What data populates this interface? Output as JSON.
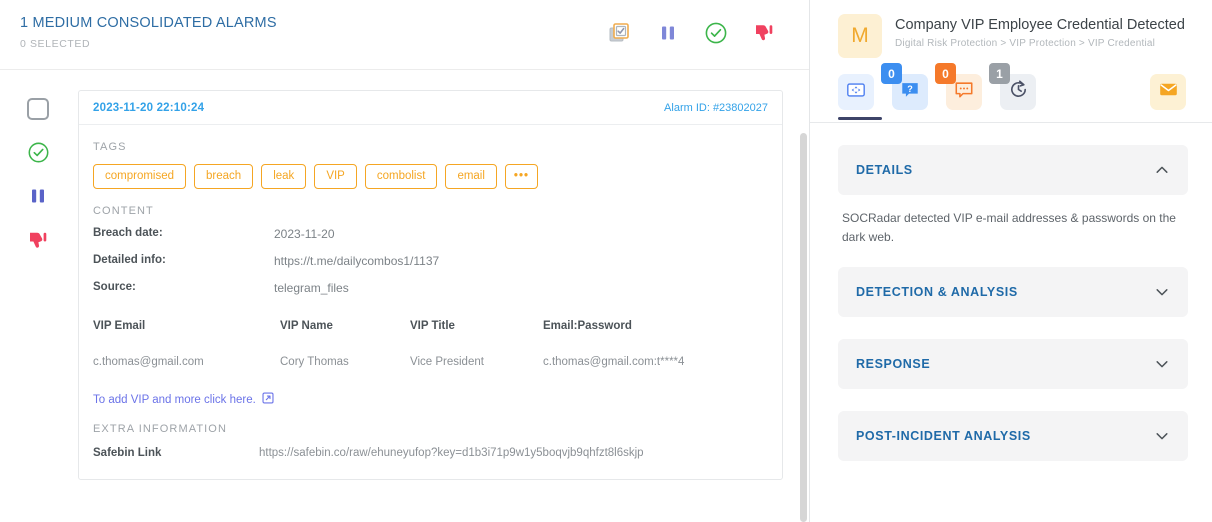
{
  "left": {
    "header": {
      "title": "1 MEDIUM CONSOLIDATED ALARMS",
      "subtitle": "0 SELECTED",
      "actions": [
        {
          "name": "select-all-icon",
          "label": "Select all"
        },
        {
          "name": "pause-icon",
          "label": "Pause"
        },
        {
          "name": "check-circle-icon",
          "label": "Resolve"
        },
        {
          "name": "thumbs-down-icon",
          "label": "False positive"
        }
      ]
    },
    "rail": [
      {
        "name": "row-checkbox",
        "label": "Select alarm"
      },
      {
        "name": "check-circle-icon",
        "label": "Resolve alarm"
      },
      {
        "name": "pause-icon",
        "label": "Pause alarm"
      },
      {
        "name": "thumbs-down-icon",
        "label": "Mark false positive"
      }
    ],
    "card": {
      "date": "2023-11-20 22:10:24",
      "alarm_id": "Alarm ID: #23802027",
      "tags_label": "TAGS",
      "tags": [
        "compromised",
        "breach",
        "leak",
        "VIP",
        "combolist",
        "email"
      ],
      "tags_more": "•••",
      "content_label": "CONTENT",
      "content_rows": [
        {
          "key": "Breach date:",
          "value": "2023-11-20"
        },
        {
          "key": "Detailed info:",
          "value": "https://t.me/dailycombos1/1137"
        },
        {
          "key": "Source:",
          "value": "telegram_files"
        }
      ],
      "vip_table": {
        "columns": [
          "VIP Email",
          "VIP Name",
          "VIP Title",
          "Email:Password"
        ],
        "rows": [
          [
            "c.thomas@gmail.com",
            "Cory Thomas",
            "Vice President",
            "c.thomas@gmail.com:t****4"
          ]
        ]
      },
      "add_vip_link": "To add VIP and more click here.",
      "extra_label": "EXTRA INFORMATION",
      "extra_rows": [
        {
          "key": "Safebin Link",
          "value": "https://safebin.co/raw/ehuneyufop?key=d1b3i71p9w1y5boqvjb9qhfzt8l6skjp"
        }
      ]
    }
  },
  "right": {
    "avatar_letter": "M",
    "title": "Company VIP Employee Credential Detected",
    "breadcrumb": "Digital Risk Protection > VIP Protection > VIP Credential",
    "tabs": [
      {
        "name": "tab-details",
        "icon": "expand-icon",
        "badge": null,
        "active": true
      },
      {
        "name": "tab-questions",
        "icon": "question-bubble-icon",
        "badge": "0",
        "active": false
      },
      {
        "name": "tab-comments",
        "icon": "comment-bubble-icon",
        "badge": "0",
        "active": false
      },
      {
        "name": "tab-history",
        "icon": "history-clock-icon",
        "badge": "1",
        "active": false
      },
      {
        "name": "tab-mail",
        "icon": "envelope-icon",
        "badge": null,
        "active": false
      }
    ],
    "sections": [
      {
        "title": "DETAILS",
        "expanded": true,
        "body": "SOCRadar detected VIP e-mail addresses & passwords on the dark web."
      },
      {
        "title": "DETECTION & ANALYSIS",
        "expanded": false,
        "body": ""
      },
      {
        "title": "RESPONSE",
        "expanded": false,
        "body": ""
      },
      {
        "title": "POST-INCIDENT ANALYSIS",
        "expanded": false,
        "body": ""
      }
    ]
  },
  "colors": {
    "accent_blue": "#33a2e8",
    "tag_orange": "#f5a623",
    "link_purple": "#6b73e8",
    "section_blue": "#1f6aa8",
    "green": "#3cb54a",
    "red": "#f0415f",
    "purple": "#5a63c8"
  }
}
